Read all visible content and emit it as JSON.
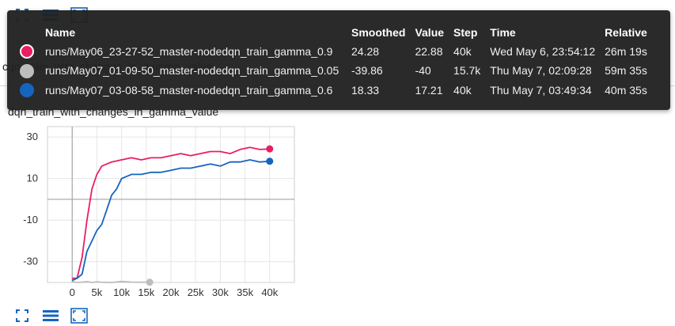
{
  "colors": {
    "series_0": "#e91e63",
    "series_1": "#bdbdbd",
    "series_2": "#1565c0",
    "accent": "#1565c0"
  },
  "toolbar": {
    "icons": [
      "fullscreen-icon",
      "toggle-data-list-icon",
      "fit-domain-icon"
    ]
  },
  "background_title": "cqn_train_with_changes_in_gamma_value",
  "tooltip": {
    "headers": {
      "name": "Name",
      "smoothed": "Smoothed",
      "value": "Value",
      "step": "Step",
      "time": "Time",
      "relative": "Relative"
    },
    "rows": [
      {
        "name": "runs/May06_23-27-52_master-nodedqn_train_gamma_0.9",
        "smoothed": "24.28",
        "value": "22.88",
        "step": "40k",
        "time": "Wed May 6, 23:54:12",
        "relative": "26m 19s"
      },
      {
        "name": "runs/May07_01-09-50_master-nodedqn_train_gamma_0.05",
        "smoothed": "-39.86",
        "value": "-40",
        "step": "15.7k",
        "time": "Thu May 7, 02:09:28",
        "relative": "59m 35s"
      },
      {
        "name": "runs/May07_03-08-58_master-nodedqn_train_gamma_0.6",
        "smoothed": "18.33",
        "value": "17.21",
        "step": "40k",
        "time": "Thu May 7, 03:49:34",
        "relative": "40m 35s"
      }
    ]
  },
  "chart_data": {
    "type": "line",
    "title": "dqn_train_with_changes_in_gamma_value",
    "xlabel": "",
    "ylabel": "",
    "xlim": [
      -5000,
      45000
    ],
    "ylim": [
      -40,
      35
    ],
    "grid": true,
    "x_ticks": [
      0,
      5000,
      10000,
      15000,
      20000,
      25000,
      30000,
      35000,
      40000
    ],
    "x_tick_labels": [
      "0",
      "5k",
      "10k",
      "15k",
      "20k",
      "25k",
      "30k",
      "35k",
      "40k"
    ],
    "y_ticks": [
      -30,
      -10,
      10,
      30
    ],
    "y_tick_labels": [
      "-30",
      "-10",
      "10",
      "30"
    ],
    "series": [
      {
        "name": "runs/May06_23-27-52_master-nodedqn_train_gamma_0.9",
        "color": "#e91e63",
        "x": [
          0,
          1000,
          2000,
          3000,
          4000,
          5000,
          6000,
          8000,
          10000,
          12000,
          14000,
          16000,
          18000,
          20000,
          22000,
          24000,
          26000,
          28000,
          30000,
          32000,
          34000,
          36000,
          38000,
          40000
        ],
        "y": [
          -38,
          -38,
          -28,
          -10,
          5,
          12,
          16,
          18,
          19,
          20,
          19,
          20,
          20,
          21,
          22,
          21,
          22,
          23,
          23,
          22,
          24,
          25,
          24,
          24.28
        ]
      },
      {
        "name": "runs/May07_01-09-50_master-nodedqn_train_gamma_0.05",
        "color": "#bdbdbd",
        "x": [
          0,
          1000,
          2000,
          3000,
          4000,
          5000,
          6000,
          8000,
          10000,
          12000,
          14000,
          15700
        ],
        "y": [
          -39.5,
          -40,
          -39.8,
          -39.6,
          -40,
          -39.7,
          -39.9,
          -40,
          -39.5,
          -39.8,
          -39.9,
          -39.86
        ]
      },
      {
        "name": "runs/May07_03-08-58_master-nodedqn_train_gamma_0.6",
        "color": "#1565c0",
        "x": [
          0,
          1000,
          2000,
          3000,
          4000,
          5000,
          6000,
          7000,
          8000,
          9000,
          10000,
          12000,
          14000,
          16000,
          18000,
          20000,
          22000,
          24000,
          26000,
          28000,
          30000,
          32000,
          34000,
          36000,
          38000,
          40000
        ],
        "y": [
          -39,
          -38,
          -36,
          -25,
          -20,
          -15,
          -12,
          -5,
          2,
          5,
          10,
          12,
          12,
          13,
          13,
          14,
          15,
          15,
          16,
          17,
          16,
          18,
          18,
          19,
          18,
          18.33
        ]
      }
    ]
  }
}
